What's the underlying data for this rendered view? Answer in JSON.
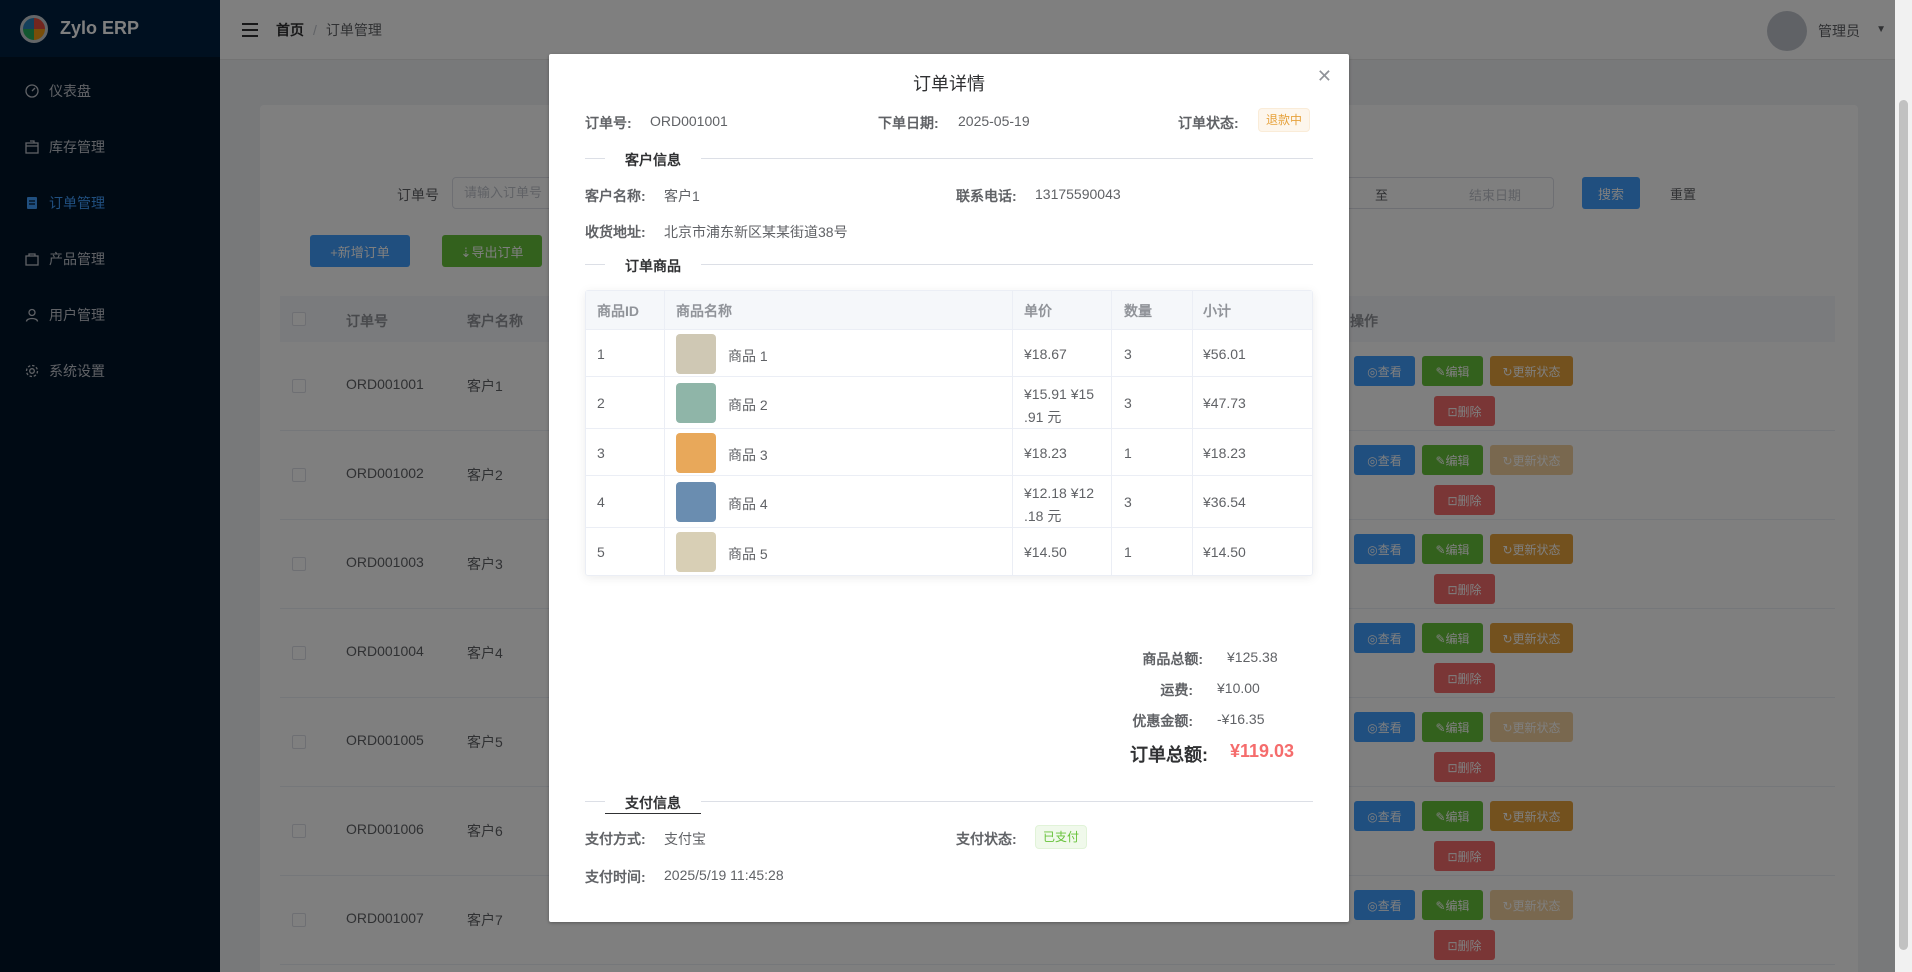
{
  "app": {
    "name": "Zylo ERP"
  },
  "sidebar": {
    "items": [
      {
        "label": "仪表盘",
        "icon": "dashboard-icon"
      },
      {
        "label": "库存管理",
        "icon": "box-icon"
      },
      {
        "label": "订单管理",
        "icon": "document-icon",
        "active": true
      },
      {
        "label": "产品管理",
        "icon": "bag-icon"
      },
      {
        "label": "用户管理",
        "icon": "user-icon"
      },
      {
        "label": "系统设置",
        "icon": "gear-icon"
      }
    ]
  },
  "header": {
    "breadcrumb_home": "首页",
    "breadcrumb_sep": "/",
    "breadcrumb_current": "订单管理",
    "username": "管理员"
  },
  "search": {
    "order_no_label": "订单号",
    "order_no_placeholder": "请输入订单号",
    "range_to": "至",
    "end_date_placeholder": "结束日期",
    "search_button": "搜索",
    "reset_button": "重置"
  },
  "toolbar": {
    "add_button": "+新增订单",
    "export_button": "⇣导出订单",
    "delete_button": "⊡"
  },
  "table": {
    "headers": {
      "order_no": "订单号",
      "customer": "客户名称",
      "actions": "操作"
    },
    "action_labels": {
      "view": "◎查看",
      "edit": "✎编辑",
      "status": "↻更新状态",
      "delete": "⊡删除"
    },
    "rows": [
      {
        "order_no": "ORD001001",
        "customer": "客户1",
        "status_enabled": true
      },
      {
        "order_no": "ORD001002",
        "customer": "客户2",
        "status_enabled": false
      },
      {
        "order_no": "ORD001003",
        "customer": "客户3",
        "status_enabled": true
      },
      {
        "order_no": "ORD001004",
        "customer": "客户4",
        "status_enabled": true
      },
      {
        "order_no": "ORD001005",
        "customer": "客户5",
        "status_enabled": false
      },
      {
        "order_no": "ORD001006",
        "customer": "客户6",
        "status_enabled": true
      },
      {
        "order_no": "ORD001007",
        "customer": "客户7",
        "status_enabled": false
      }
    ]
  },
  "dialog": {
    "title": "订单详情",
    "order_no_label": "订单号:",
    "order_no": "ORD001001",
    "order_date_label": "下单日期:",
    "order_date": "2025-05-19",
    "status_label": "订单状态:",
    "status": "退款中",
    "customer_section": "客户信息",
    "customer_name_label": "客户名称:",
    "customer_name": "客户1",
    "phone_label": "联系电话:",
    "phone": "13175590043",
    "address_label": "收货地址:",
    "address": "北京市浦东新区某某街道38号",
    "items_section": "订单商品",
    "item_headers": {
      "id": "商品ID",
      "name": "商品名称",
      "price": "单价",
      "qty": "数量",
      "subtotal": "小计"
    },
    "items": [
      {
        "id": "1",
        "name": "商品 1",
        "price_line1": "¥18.67",
        "price_line2": "",
        "qty": "3",
        "subtotal": "¥56.01",
        "thumb": "#cfc8b4"
      },
      {
        "id": "2",
        "name": "商品 2",
        "price_line1": "¥15.91  ¥15",
        "price_line2": ".91 元",
        "qty": "3",
        "subtotal": "¥47.73",
        "thumb": "#8fb5a8"
      },
      {
        "id": "3",
        "name": "商品 3",
        "price_line1": "¥18.23",
        "price_line2": "",
        "qty": "1",
        "subtotal": "¥18.23",
        "thumb": "#e8a85a"
      },
      {
        "id": "4",
        "name": "商品 4",
        "price_line1": "¥12.18  ¥12",
        "price_line2": ".18 元",
        "qty": "3",
        "subtotal": "¥36.54",
        "thumb": "#6a8db0"
      },
      {
        "id": "5",
        "name": "商品 5",
        "price_line1": "¥14.50",
        "price_line2": "",
        "qty": "1",
        "subtotal": "¥14.50",
        "thumb": "#d8cfb5"
      }
    ],
    "goods_total_label": "商品总额:",
    "goods_total": "¥125.38",
    "shipping_label": "运费:",
    "shipping": "¥10.00",
    "discount_label": "优惠金额:",
    "discount": "-¥16.35",
    "order_total_label": "订单总额:",
    "order_total": "¥119.03",
    "payment_section": "支付信息",
    "pay_method_label": "支付方式:",
    "pay_method": "支付宝",
    "pay_status_label": "支付状态:",
    "pay_status": "已支付",
    "pay_time_label": "支付时间:",
    "pay_time": "2025/5/19 11:45:28"
  }
}
